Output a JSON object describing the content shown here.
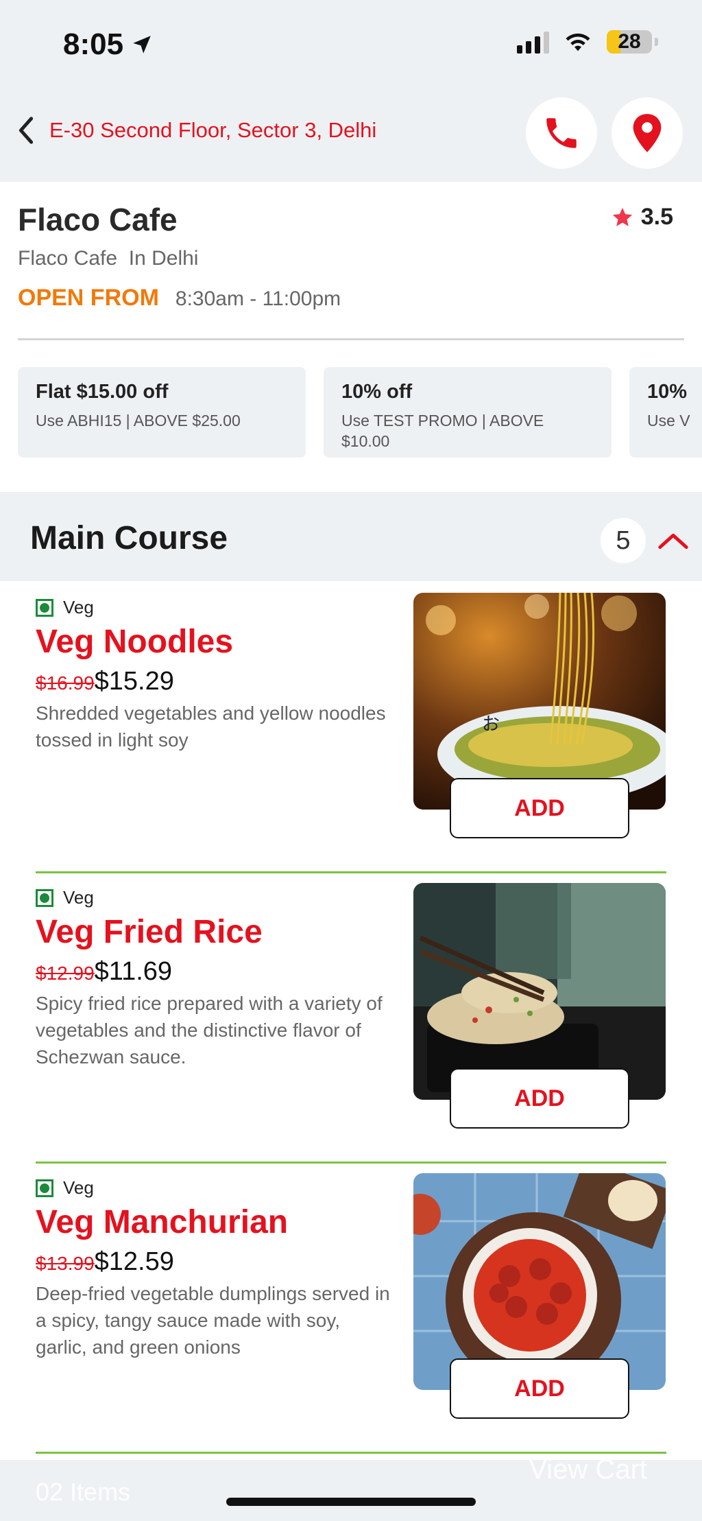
{
  "status": {
    "time": "8:05",
    "battery": "28"
  },
  "header": {
    "address": "E-30 Second Floor, Sector 3, Delhi"
  },
  "restaurant": {
    "name": "Flaco Cafe",
    "subtitle": "Flaco Cafe  In Delhi",
    "rating": "3.5",
    "open_label": "OPEN FROM",
    "hours": "8:30am - 11:00pm"
  },
  "offers": [
    {
      "title": "Flat $15.00 off",
      "subtitle": "Use ABHI15 | ABOVE $25.00"
    },
    {
      "title": "10% off",
      "subtitle": "Use TEST PROMO | ABOVE $10.00"
    },
    {
      "title": "10%",
      "subtitle": "Use V"
    }
  ],
  "section": {
    "title": "Main Course",
    "count": "5"
  },
  "items": [
    {
      "veg_label": "Veg",
      "name": "Veg Noodles",
      "old_price": "$16.99",
      "price": "$15.29",
      "description": "Shredded vegetables and yellow noodles tossed in light soy",
      "add_label": "ADD"
    },
    {
      "veg_label": "Veg",
      "name": "Veg Fried Rice",
      "old_price": "$12.99",
      "price": "$11.69",
      "description": "Spicy fried rice prepared with a variety of vegetables and the distinctive flavor of Schezwan sauce.",
      "add_label": "ADD"
    },
    {
      "veg_label": "Veg",
      "name": "Veg Manchurian",
      "old_price": "$13.99",
      "price": "$12.59",
      "description": "Deep-fried vegetable dumplings served in a spicy, tangy sauce made with soy, garlic, and green onions",
      "add_label": "ADD"
    }
  ],
  "cart": {
    "items_label": "02 Items",
    "view_label": "View Cart"
  },
  "colors": {
    "accent": "#e4121e",
    "open": "#f07a0a",
    "veg": "#1c8a3a",
    "separator": "#7cc242"
  }
}
